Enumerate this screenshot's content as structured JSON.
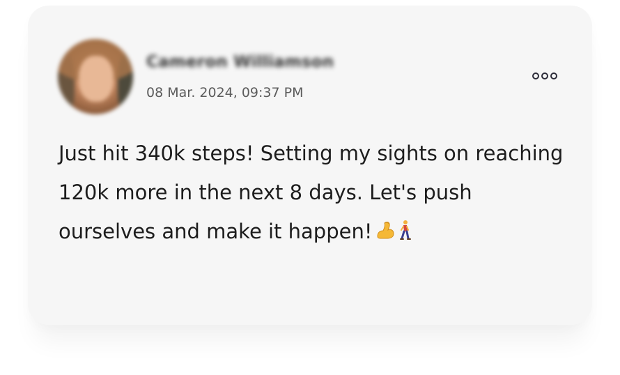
{
  "post": {
    "author_name": "Cameron Williamson",
    "timestamp": "08 Mar. 2024, 09:37 PM",
    "body": "Just hit 340k steps! Setting my sights on reaching 120k more in the next 8 days. Let's push ourselves and make it happen!",
    "emojis": [
      "flexed-biceps",
      "person-walking"
    ]
  },
  "icons": {
    "more": "more-options-icon"
  }
}
